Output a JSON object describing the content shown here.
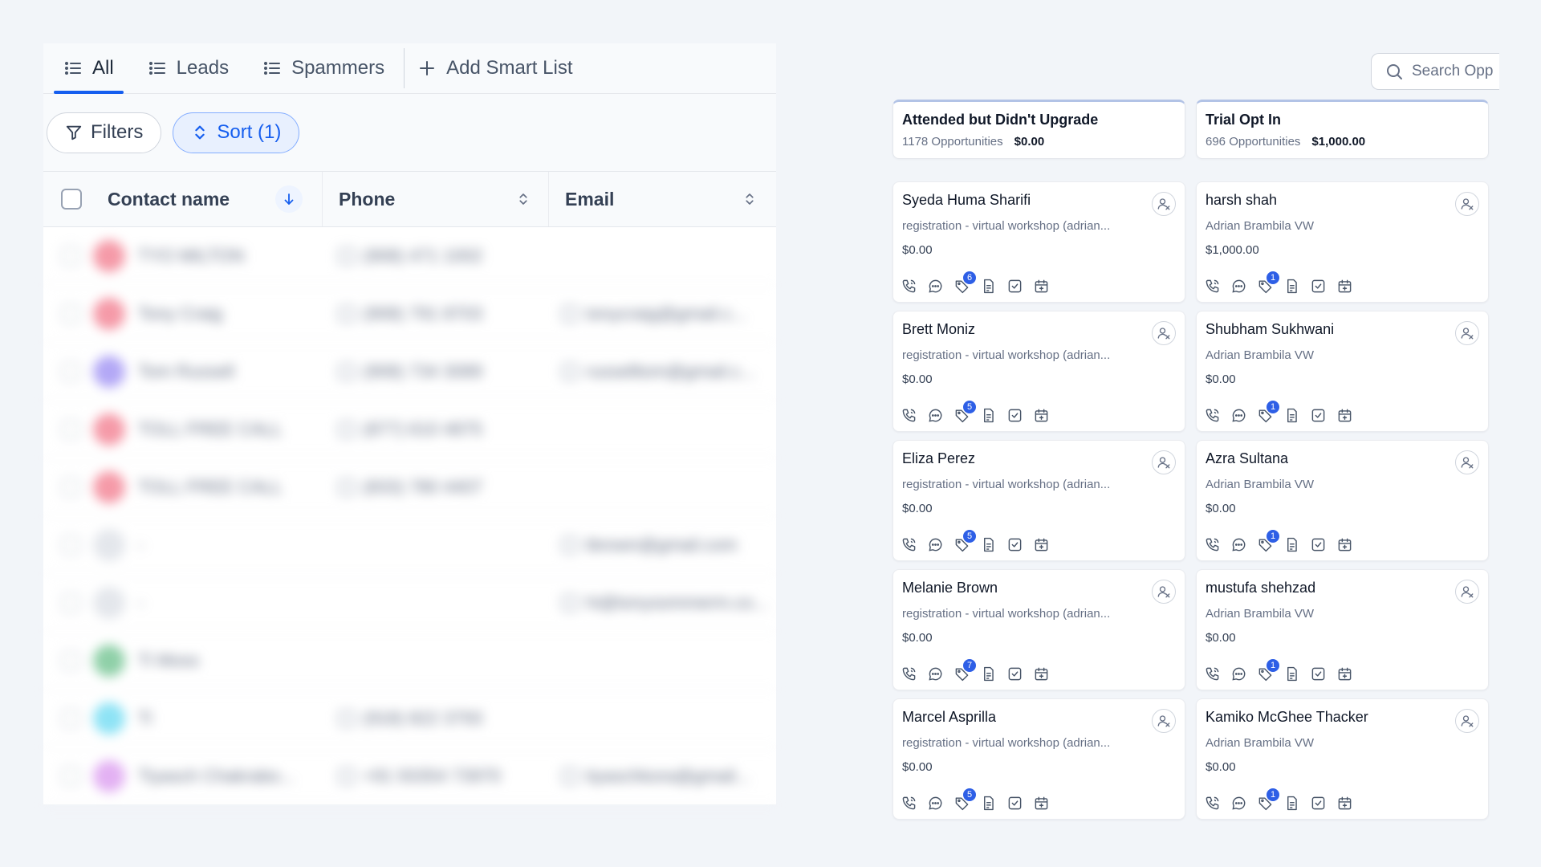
{
  "tabs": [
    {
      "label": "All",
      "active": true,
      "icon": "list-icon"
    },
    {
      "label": "Leads",
      "active": false,
      "icon": "list-icon"
    },
    {
      "label": "Spammers",
      "active": false,
      "icon": "list-icon"
    }
  ],
  "add_smart_list": "Add Smart List",
  "toolbar": {
    "filters_label": "Filters",
    "sort_label": "Sort (1)"
  },
  "table": {
    "columns": {
      "name": "Contact name",
      "phone": "Phone",
      "email": "Email"
    },
    "rows": [
      {
        "name": "TYO MILTON",
        "phone": "(908) 471 1002",
        "email": "",
        "avatar_color": "#f59aa8"
      },
      {
        "name": "Tony Craig",
        "phone": "(908) 791 8703",
        "email": "tonycraig@gmail.c...",
        "avatar_color": "#f59aa8"
      },
      {
        "name": "Tom Russell",
        "phone": "(908) 734 3089",
        "email": "russelltom@gmail.c...",
        "avatar_color": "#b3a8f6"
      },
      {
        "name": "TOLL FREE CALL",
        "phone": "(877) 610 4875",
        "email": "",
        "avatar_color": "#f59aa8"
      },
      {
        "name": "TOLL FREE CALL",
        "phone": "(833) 780 4407",
        "email": "",
        "avatar_color": "#f59aa8"
      },
      {
        "name": "-",
        "phone": "",
        "email": "tbrown@gmail.com",
        "avatar_color": "#e4e7ec"
      },
      {
        "name": "-",
        "phone": "",
        "email": "hi@tonysommerm.co...",
        "avatar_color": "#e4e7ec"
      },
      {
        "name": "Ti Moss",
        "phone": "",
        "email": "",
        "avatar_color": "#8fd0a8"
      },
      {
        "name": "Ti",
        "phone": "(918) 822 3793",
        "email": "",
        "avatar_color": "#8ee3f5"
      },
      {
        "name": "Tiyasch Chakrabo...",
        "phone": "+91 93354 73970",
        "email": "tiyaschkora@gmail...",
        "avatar_color": "#e3b1f3"
      }
    ]
  },
  "search": {
    "placeholder": "Search Opp"
  },
  "pipeline": {
    "columns": [
      {
        "title": "Attended but Didn't Upgrade",
        "count": "1178 Opportunities",
        "total": "$0.00",
        "cards": [
          {
            "name": "Syeda Huma Sharifi",
            "source": "registration - virtual workshop (adrian...",
            "value": "$0.00",
            "badge": "6"
          },
          {
            "name": "Brett Moniz",
            "source": "registration - virtual workshop (adrian...",
            "value": "$0.00",
            "badge": "5"
          },
          {
            "name": "Eliza Perez",
            "source": "registration - virtual workshop (adrian...",
            "value": "$0.00",
            "badge": "5"
          },
          {
            "name": "Melanie Brown",
            "source": "registration - virtual workshop (adrian...",
            "value": "$0.00",
            "badge": "7"
          },
          {
            "name": "Marcel Asprilla",
            "source": "registration - virtual workshop (adrian...",
            "value": "$0.00",
            "badge": "5"
          }
        ]
      },
      {
        "title": "Trial Opt In",
        "count": "696 Opportunities",
        "total": "$1,000.00",
        "cards": [
          {
            "name": "harsh shah",
            "source": "Adrian Brambila VW",
            "value": "$1,000.00",
            "badge": "1"
          },
          {
            "name": "Shubham Sukhwani",
            "source": "Adrian Brambila VW",
            "value": "$0.00",
            "badge": "1"
          },
          {
            "name": "Azra Sultana",
            "source": "Adrian Brambila VW",
            "value": "$0.00",
            "badge": "1"
          },
          {
            "name": "mustufa shehzad",
            "source": "Adrian Brambila VW",
            "value": "$0.00",
            "badge": "1"
          },
          {
            "name": "Kamiko McGhee Thacker",
            "source": "Adrian Brambila VW",
            "value": "$0.00",
            "badge": "1"
          }
        ]
      }
    ]
  },
  "colors": {
    "accent": "#155eef",
    "badge": "#2e5fe6"
  }
}
